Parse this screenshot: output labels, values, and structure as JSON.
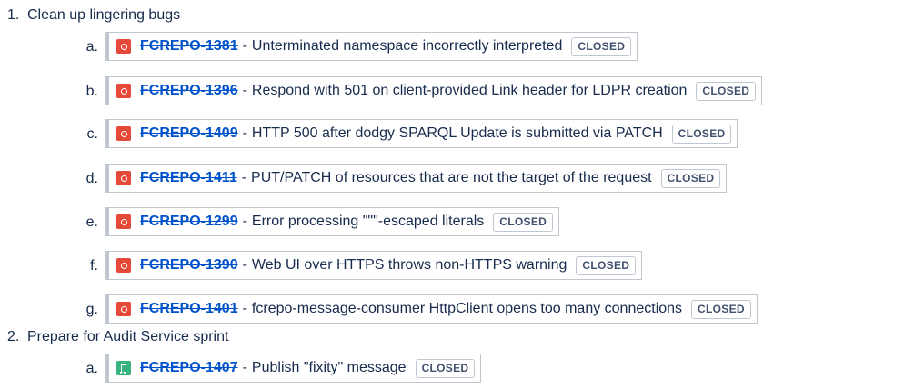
{
  "items": [
    {
      "number": "1.",
      "title": "Clean up lingering bugs",
      "subitems": [
        {
          "letter": "a.",
          "icon": "bug-icon",
          "key": "FCREPO-1381",
          "summary": "Unterminated namespace incorrectly interpreted",
          "status": "CLOSED"
        },
        {
          "letter": "b.",
          "icon": "bug-icon",
          "key": "FCREPO-1396",
          "summary": "Respond with 501 on client-provided Link header for LDPR creation",
          "status": "CLOSED"
        },
        {
          "letter": "c.",
          "icon": "bug-icon",
          "key": "FCREPO-1409",
          "summary": "HTTP 500 after dodgy SPARQL Update is submitted via PATCH",
          "status": "CLOSED"
        },
        {
          "letter": "d.",
          "icon": "bug-icon",
          "key": "FCREPO-1411",
          "summary": "PUT/PATCH of resources that are not the target of the request",
          "status": "CLOSED"
        },
        {
          "letter": "e.",
          "icon": "bug-icon",
          "key": "FCREPO-1299",
          "summary": "Error processing \"\"\"-escaped literals",
          "status": "CLOSED"
        },
        {
          "letter": "f.",
          "icon": "bug-icon",
          "key": "FCREPO-1390",
          "summary": "Web UI over HTTPS throws non-HTTPS warning",
          "status": "CLOSED"
        },
        {
          "letter": "g.",
          "icon": "bug-icon",
          "key": "FCREPO-1401",
          "summary": "fcrepo-message-consumer HttpClient opens too many connections",
          "status": "CLOSED"
        }
      ]
    },
    {
      "number": "2.",
      "title": "Prepare for Audit Service sprint",
      "subitems": [
        {
          "letter": "a.",
          "icon": "story-icon",
          "key": "FCREPO-1407",
          "summary": "Publish \"fixity\" message",
          "status": "CLOSED"
        }
      ]
    }
  ]
}
